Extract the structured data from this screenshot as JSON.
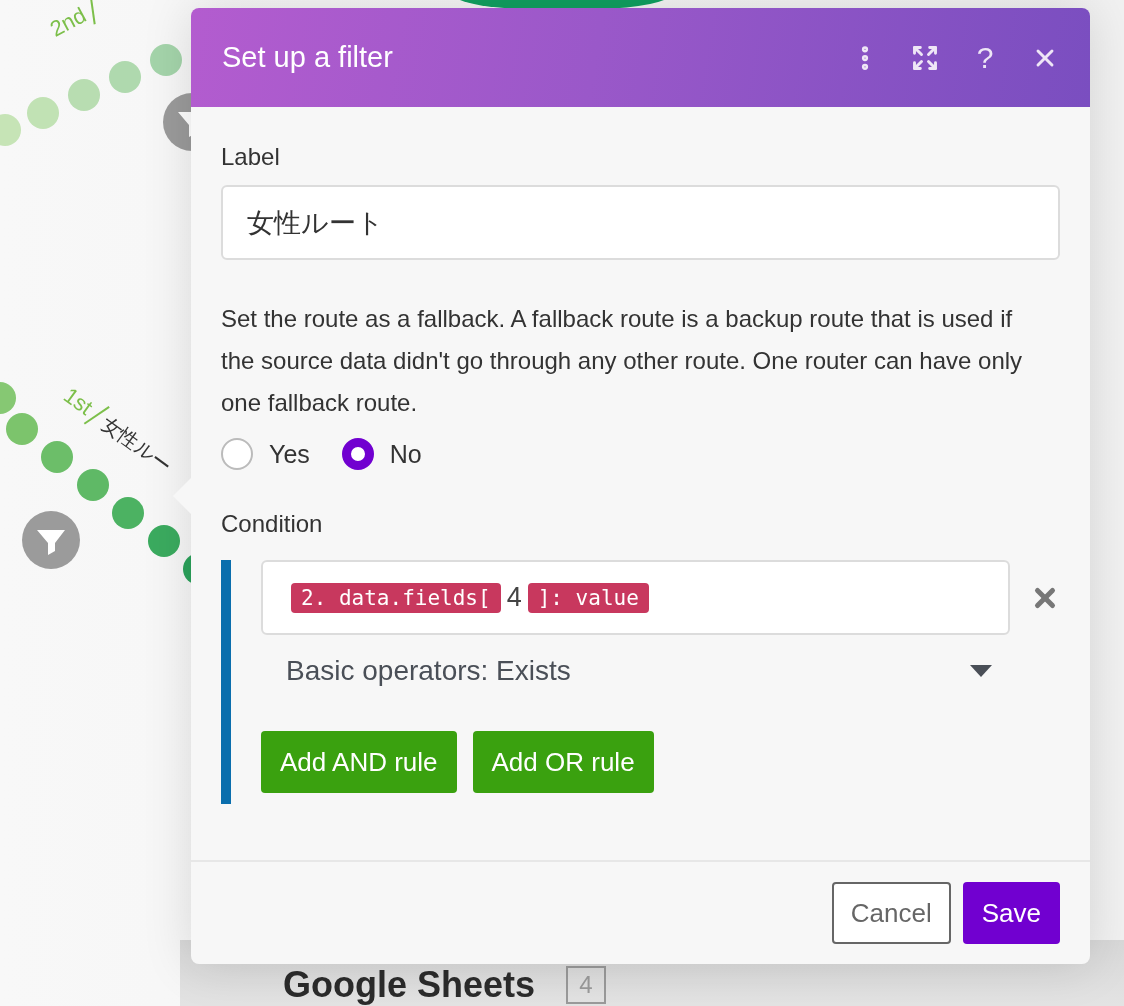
{
  "canvas": {
    "routes": [
      {
        "order": "2nd"
      },
      {
        "order": "1st",
        "label": "女性ルー"
      }
    ],
    "module": {
      "title": "Google Sheets",
      "badge": "4"
    }
  },
  "dialog": {
    "title": "Set up a filter",
    "help_glyph": "?",
    "label_field": {
      "label": "Label",
      "value": "女性ルート"
    },
    "fallback": {
      "description": "Set the route as a fallback. A fallback route is a backup route that is used if the source data didn't go through any other route. One router can have only one fallback route.",
      "options": [
        {
          "label": "Yes",
          "selected": false
        },
        {
          "label": "No",
          "selected": true
        }
      ]
    },
    "condition": {
      "label": "Condition",
      "tokens": [
        {
          "kind": "pill",
          "text": "2. data.fields["
        },
        {
          "kind": "plain",
          "text": "4"
        },
        {
          "kind": "pill",
          "text": "]: value"
        }
      ],
      "operator": "Basic operators: Exists",
      "buttons": [
        "Add AND rule",
        "Add OR rule"
      ]
    },
    "footer": [
      {
        "label": "Cancel",
        "kind": "secondary"
      },
      {
        "label": "Save",
        "kind": "primary"
      }
    ]
  }
}
